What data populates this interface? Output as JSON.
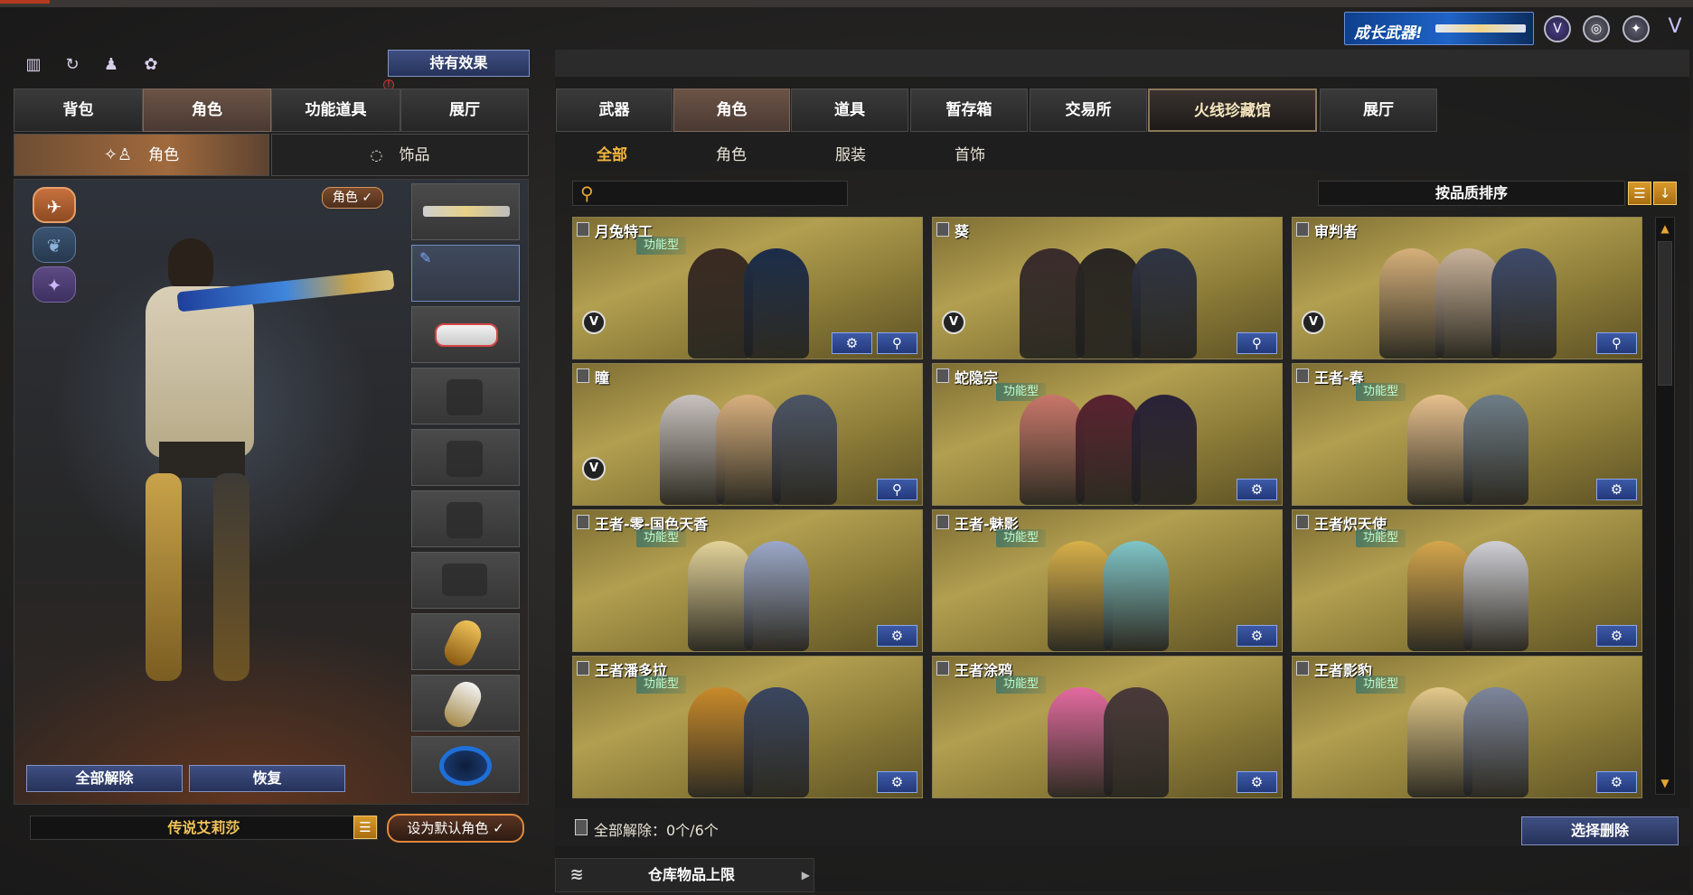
{
  "banner": {
    "text": "成长武器!"
  },
  "left": {
    "holding_effect": "持有效果",
    "tabs": [
      "背包",
      "角色",
      "功能道具",
      "展厅"
    ],
    "subtabs": [
      "角色",
      "饰品"
    ],
    "char_badge": "角色 ✓",
    "unequip_all": "全部解除",
    "restore": "恢复",
    "char_name": "传说艾莉莎",
    "set_default": "设为默认角色 ✓"
  },
  "right": {
    "tabs": [
      "武器",
      "角色",
      "道具",
      "暂存箱",
      "交易所",
      "火线珍藏馆",
      "展厅"
    ],
    "filters": [
      "全部",
      "角色",
      "服装",
      "首饰"
    ],
    "sort_label": "按品质排序",
    "cards": [
      {
        "title": "月兔特工",
        "tag": "功能型",
        "v": "V"
      },
      {
        "title": "葵",
        "tag": "",
        "v": "V"
      },
      {
        "title": "审判者",
        "tag": "",
        "v": "V"
      },
      {
        "title": "瞳",
        "tag": "",
        "v": "V"
      },
      {
        "title": "蛇隐宗",
        "tag": "功能型",
        "v": ""
      },
      {
        "title": "王者-春",
        "tag": "功能型",
        "v": ""
      },
      {
        "title": "王者-零-国色天香",
        "tag": "功能型",
        "v": ""
      },
      {
        "title": "王者-魅影",
        "tag": "功能型",
        "v": ""
      },
      {
        "title": "王者炽天使",
        "tag": "功能型",
        "v": ""
      },
      {
        "title": "王者潘多拉",
        "tag": "功能型",
        "v": ""
      },
      {
        "title": "王者涂鸦",
        "tag": "功能型",
        "v": ""
      },
      {
        "title": "王者影豹",
        "tag": "功能型",
        "v": ""
      }
    ],
    "unlock_all_text": "全部解除：0个/6个",
    "select_delete": "选择删除",
    "warehouse_limit": "仓库物品上限"
  }
}
